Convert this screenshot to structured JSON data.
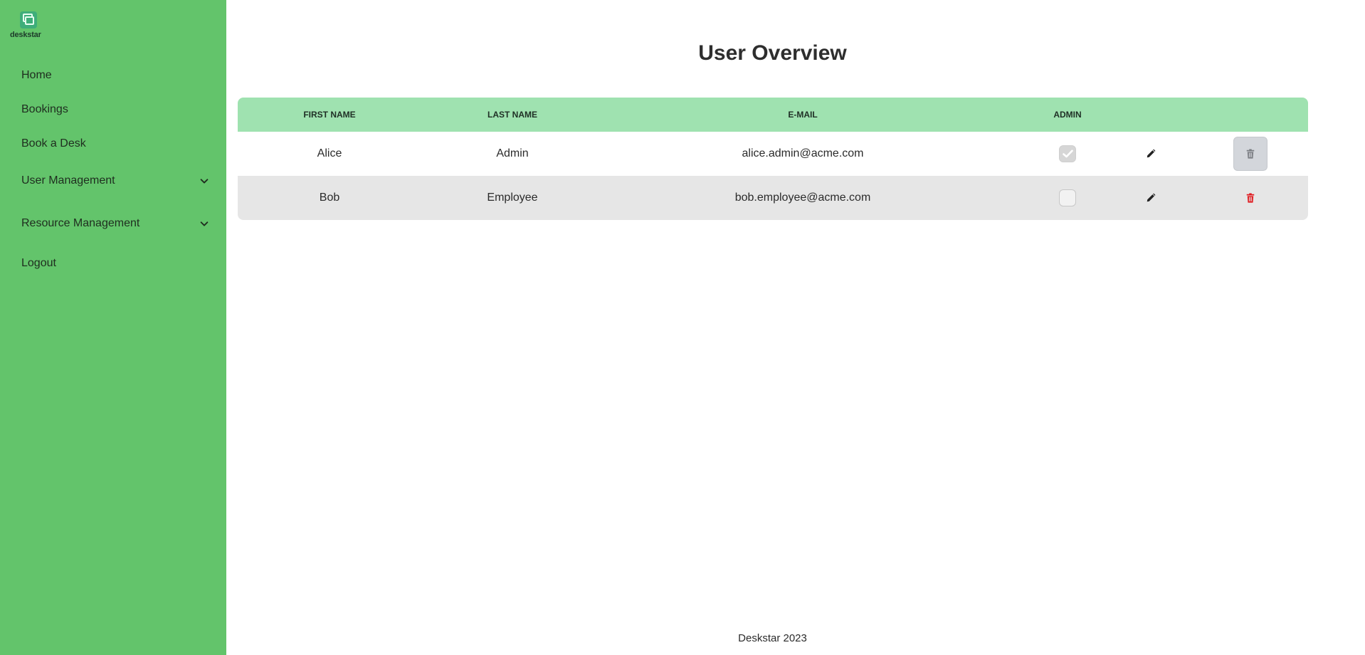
{
  "app": {
    "logo_text": "deskstar"
  },
  "sidebar": {
    "items": [
      {
        "label": "Home",
        "has_dropdown": false
      },
      {
        "label": "Bookings",
        "has_dropdown": false
      },
      {
        "label": "Book a Desk",
        "has_dropdown": false
      },
      {
        "label": "User Management",
        "has_dropdown": true
      },
      {
        "label": "Resource Management",
        "has_dropdown": true
      },
      {
        "label": "Logout",
        "has_dropdown": false
      }
    ]
  },
  "main": {
    "title": "User Overview",
    "table": {
      "columns": [
        "FIRST NAME",
        "LAST NAME",
        "E-MAIL",
        "ADMIN"
      ],
      "rows": [
        {
          "first_name": "Alice",
          "last_name": "Admin",
          "email": "alice.admin@acme.com",
          "admin": true,
          "delete_enabled": false
        },
        {
          "first_name": "Bob",
          "last_name": "Employee",
          "email": "bob.employee@acme.com",
          "admin": false,
          "delete_enabled": true
        }
      ]
    }
  },
  "footer": {
    "text": "Deskstar 2023"
  },
  "colors": {
    "sidebar_bg": "#63c46b",
    "header_bg": "#9fe2b0",
    "alt_row_bg": "#e6e6e6",
    "delete_red": "#e0191e"
  },
  "icons": {
    "edit": "pencil-icon",
    "delete": "trash-icon",
    "dropdown": "chevron-down-icon",
    "check": "check-icon"
  }
}
